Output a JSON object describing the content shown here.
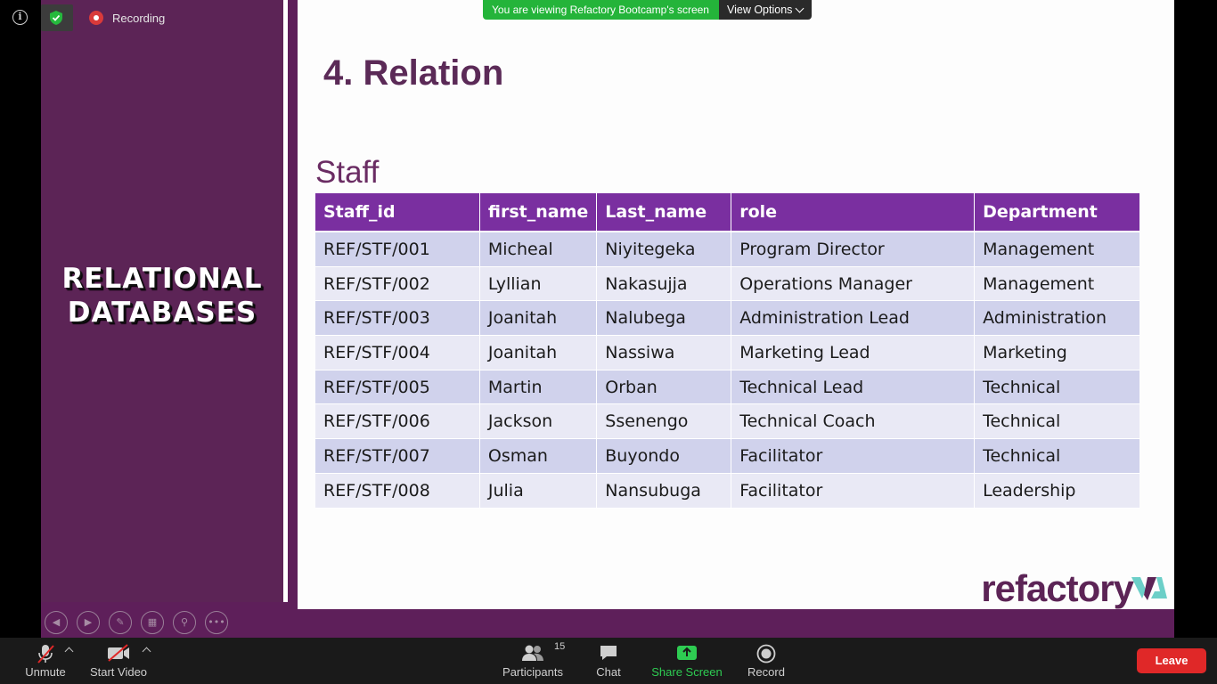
{
  "status": {
    "recording_label": "Recording",
    "recording_color": "#d93a3a",
    "encryption_icon": "shield-check-icon",
    "info_icon": "info-icon"
  },
  "banner": {
    "viewing_text": "You are viewing Refactory Bootcamp's screen",
    "view_options_label": "View Options",
    "green": "#24b43a"
  },
  "slide": {
    "side_title_line1": "RELATIONAL",
    "side_title_line2": "DATABASES",
    "heading": "4. Relation",
    "table_title": "Staff",
    "logo_text": "refactory",
    "accent": "#7a2fa0",
    "brand": "#5c2456",
    "table": {
      "headers": [
        "Staff_id",
        "first_name",
        "Last_name",
        "role",
        "Department"
      ],
      "rows": [
        [
          "REF/STF/001",
          "Micheal",
          "Niyitegeka",
          "Program Director",
          "Management"
        ],
        [
          "REF/STF/002",
          "Lyllian",
          "Nakasujja",
          "Operations Manager",
          "Management"
        ],
        [
          "REF/STF/003",
          "Joanitah",
          "Nalubega",
          "Administration Lead",
          "Administration"
        ],
        [
          "REF/STF/004",
          "Joanitah",
          "Nassiwa",
          "Marketing Lead",
          "Marketing"
        ],
        [
          "REF/STF/005",
          "Martin",
          "Orban",
          "Technical Lead",
          "Technical"
        ],
        [
          "REF/STF/006",
          "Jackson",
          "Ssenengo",
          "Technical Coach",
          "Technical"
        ],
        [
          "REF/STF/007",
          "Osman",
          "Buyondo",
          "Facilitator",
          "Technical"
        ],
        [
          "REF/STF/008",
          "Julia",
          "Nansubuga",
          "Facilitator",
          "Leadership"
        ]
      ]
    }
  },
  "slide_controls": [
    "previous-slide-icon",
    "next-slide-icon",
    "pen-icon",
    "slides-grid-icon",
    "zoom-icon",
    "more-icon"
  ],
  "toolbar": {
    "unmute_label": "Unmute",
    "start_video_label": "Start Video",
    "participants_label": "Participants",
    "participants_count": "15",
    "chat_label": "Chat",
    "share_screen_label": "Share Screen",
    "record_label": "Record",
    "leave_label": "Leave",
    "leave_color": "#e02828",
    "share_color": "#2ecc52"
  }
}
